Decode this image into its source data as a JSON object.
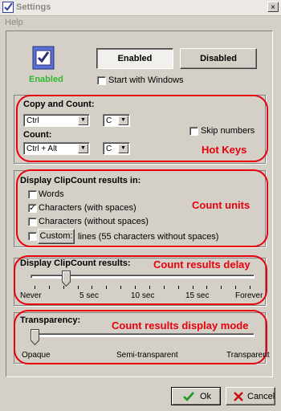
{
  "window": {
    "title": "Settings",
    "close_glyph": "×"
  },
  "menu": {
    "help": "Help"
  },
  "status": {
    "icon": "checkbox-app-icon",
    "label": "Enabled",
    "label_color": "#2eb82e"
  },
  "toggle": {
    "enabled_label": "Enabled",
    "disabled_label": "Disabled",
    "start_with_windows": "Start with Windows",
    "start_with_windows_checked": false
  },
  "hotkeys": {
    "copy_and_count_label": "Copy and Count:",
    "copy_modifier": "Ctrl",
    "copy_key": "C",
    "count_label": "Count:",
    "count_modifier": "Ctrl + Alt",
    "count_key": "C",
    "skip_numbers": "Skip numbers",
    "skip_numbers_checked": false,
    "annotation": "Hot Keys"
  },
  "units": {
    "header": "Display ClipCount results in:",
    "words": "Words",
    "words_checked": false,
    "chars_with_spaces": "Characters (with spaces)",
    "chars_with_spaces_checked": true,
    "chars_without_spaces": "Characters (without spaces)",
    "chars_without_spaces_checked": false,
    "custom_button": "Custom:",
    "custom_checked": false,
    "custom_lines": "lines (55 characters without spaces)",
    "annotation": "Count units"
  },
  "delay": {
    "header": "Display ClipCount results:",
    "annotation": "Count results delay",
    "ticks": [
      "Never",
      "5 sec",
      "10 sec",
      "15 sec",
      "Forever"
    ],
    "value": "3 sec"
  },
  "transparency": {
    "header": "Transparency:",
    "annotation": "Count results display mode",
    "ticks": [
      "Opaque",
      "Semi-transparent",
      "Transparent"
    ],
    "value": "Opaque"
  },
  "footer": {
    "ok": "Ok",
    "cancel": "Cancel"
  },
  "colors": {
    "annotation_red": "#e8000b",
    "ok_green": "#1e9a1e",
    "cancel_red": "#c81414"
  }
}
